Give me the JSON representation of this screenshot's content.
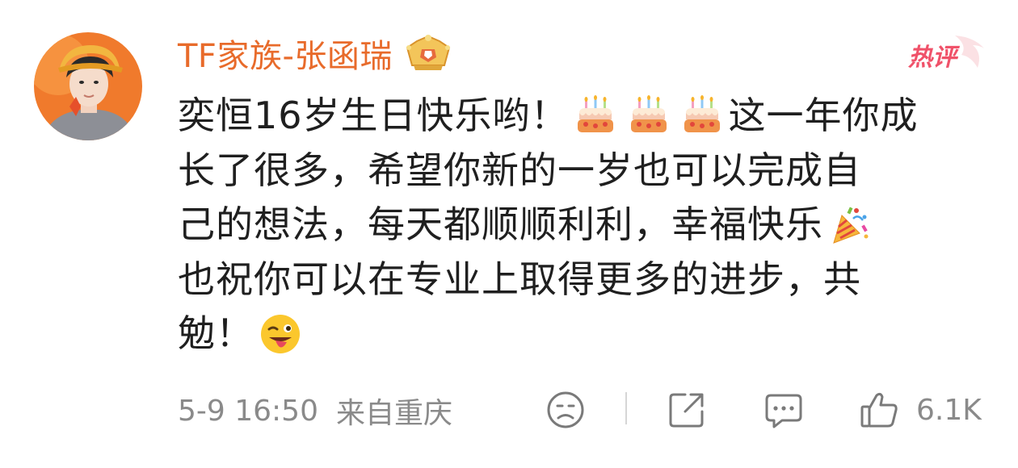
{
  "comment": {
    "username": "TF家族-张函瑞",
    "badge_icon": "crown-badge-icon",
    "hot_label": "热评",
    "lines": [
      {
        "segments": [
          {
            "t": "text",
            "v": "奕恒16岁生日快乐哟！"
          },
          {
            "t": "emoji",
            "v": "birthday-cake-icon"
          },
          {
            "t": "emoji",
            "v": "birthday-cake-icon"
          },
          {
            "t": "emoji",
            "v": "birthday-cake-icon"
          },
          {
            "t": "text",
            "v": "这一年你成"
          }
        ]
      },
      {
        "segments": [
          {
            "t": "text",
            "v": "长了很多，希望你新的一岁也可以完成自"
          }
        ]
      },
      {
        "segments": [
          {
            "t": "text",
            "v": "己的想法，每天都顺顺利利，幸福快乐"
          },
          {
            "t": "emoji",
            "v": "party-popper-icon"
          }
        ]
      },
      {
        "segments": [
          {
            "t": "text",
            "v": "也祝你可以在专业上取得更多的进步，共"
          }
        ]
      },
      {
        "segments": [
          {
            "t": "text",
            "v": "勉！"
          },
          {
            "t": "emoji",
            "v": "winking-tongue-face-icon"
          }
        ]
      }
    ],
    "timestamp": "5-9 16:50",
    "location": "来自重庆",
    "like_count": "6.1K"
  },
  "colors": {
    "username": "#e86b2b",
    "hot": "#f0526a",
    "text": "#1f1f1f",
    "meta": "#8a8a8a",
    "avatar_bg": "#f07a2c"
  }
}
